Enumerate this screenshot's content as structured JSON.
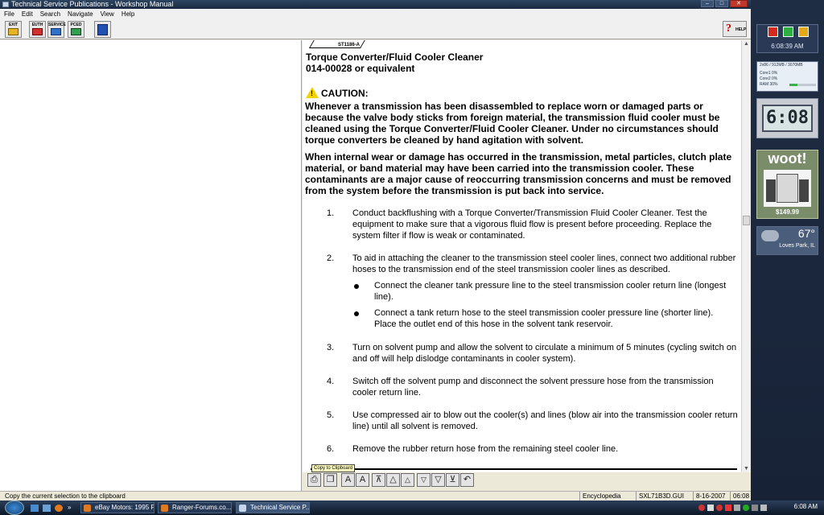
{
  "window": {
    "title": "Technical Service Publications - Workshop Manual",
    "controls": [
      "–",
      "□",
      "✕"
    ]
  },
  "menu": [
    "File",
    "Edit",
    "Search",
    "Navigate",
    "View",
    "Help"
  ],
  "toolbar": {
    "buttons": [
      {
        "label": "EXIT",
        "icon": "exit-icon"
      },
      {
        "label": "EUTH",
        "icon": "euth-icon"
      },
      {
        "label": "SERVICE",
        "icon": "service-icon"
      },
      {
        "label": "PCED",
        "icon": "pced-icon"
      },
      {
        "label": "",
        "icon": "manual-icon"
      }
    ],
    "help_label": "HELP"
  },
  "document": {
    "figure_code": "ST1186-A",
    "heading": "Torque Converter/Fluid Cooler Cleaner",
    "part_number": "014-00028 or equivalent",
    "caution_label": "CAUTION:",
    "caution_text": "Whenever a transmission has been disassembled to replace worn or damaged parts or because the valve body sticks from foreign material, the transmission fluid cooler must be cleaned using the Torque Converter/Fluid Cooler Cleaner. Under no circumstances should torque converters be cleaned by hand agitation with solvent.",
    "internal_text": "When internal wear or damage has occurred in the transmission, metal particles, clutch plate material, or band material may have been carried into the transmission cooler. These contaminants are a major cause of reoccurring transmission concerns and must be removed from the system before the transmission is put back into service.",
    "steps": [
      {
        "num": "1.",
        "text": "Conduct backflushing with a Torque Converter/Transmission Fluid Cooler Cleaner. Test the equipment to make sure that a vigorous fluid flow is present before proceeding. Replace the system filter if flow is weak or contaminated."
      },
      {
        "num": "2.",
        "text": "To aid in attaching the cleaner to the transmission steel cooler lines, connect two additional rubber hoses to the transmission end of the steel transmission cooler lines as described."
      },
      {
        "num": "3.",
        "text": "Turn on solvent pump and allow the solvent to circulate a minimum of 5 minutes (cycling switch on and off will help dislodge contaminants in cooler system)."
      },
      {
        "num": "4.",
        "text": "Switch off the solvent pump and disconnect the solvent pressure hose from the transmission cooler return line."
      },
      {
        "num": "5.",
        "text": "Use compressed air to blow out the cooler(s) and lines (blow air into the transmission cooler return line) until all solvent is removed."
      },
      {
        "num": "6.",
        "text": "Remove the rubber return hose from the remaining steel cooler line."
      }
    ],
    "bullets": [
      "Connect the cleaner tank pressure line to the steel transmission cooler return line (longest line).",
      "Connect a tank return hose to the steel transmission cooler pressure line (shorter line). Place the outlet end of this hose in the solvent tank reservoir."
    ]
  },
  "tooltip": "Copy to Clipboard",
  "status": {
    "message": "Copy the current selection to the clipboard",
    "section": "Encyclopedia",
    "file": "SXL71B3D.GUI",
    "date": "8-16-2007",
    "time": "06:08"
  },
  "sidebar": {
    "clock_time": "6:08:39 AM",
    "cpu": {
      "header": "2x86 / 912MB / 3070MB",
      "core1": "Core1  0%",
      "core2": "Core2  0%",
      "ram": "RAM  30%",
      "ram_pct": 30
    },
    "digital_clock": "6:08",
    "woot_logo": "woot!",
    "woot_price": "$149.99",
    "weather_temp": "67°",
    "weather_location": "Loves Park, IL"
  },
  "taskbar": {
    "tasks": [
      "eBay Motors: 1995 F...",
      "Ranger-Forums.co...",
      "Technical Service P..."
    ],
    "clock": "6:08 AM"
  }
}
